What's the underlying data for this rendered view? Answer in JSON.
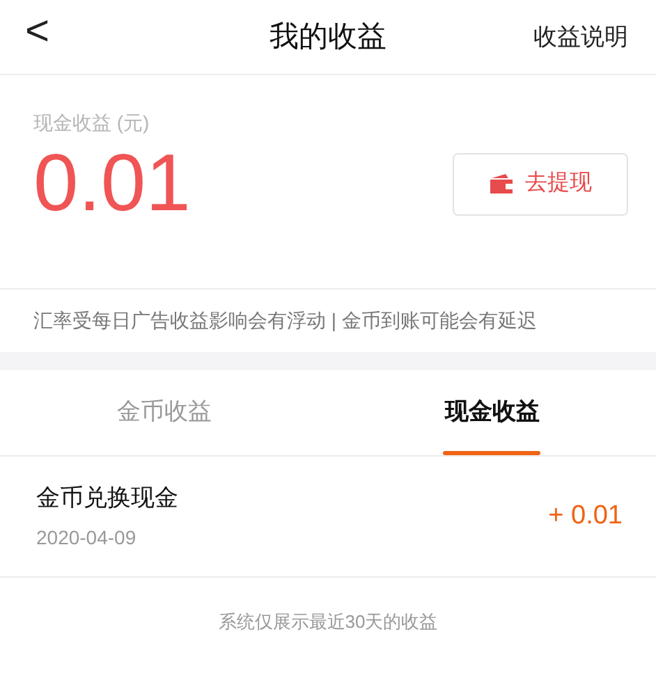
{
  "header": {
    "back": "<",
    "title": "我的收益",
    "action": "收益说明"
  },
  "balance": {
    "label": "现金收益 (元)",
    "amount": "0.01",
    "withdraw_button": "去提现"
  },
  "notice": "汇率受每日广告收益影响会有浮动 | 金币到账可能会有延迟",
  "tabs": [
    {
      "label": "金币收益",
      "selected": false
    },
    {
      "label": "现金收益",
      "selected": true
    }
  ],
  "records": [
    {
      "title": "金币兑换现金",
      "date": "2020-04-09",
      "amount": "+ 0.01"
    }
  ],
  "footer": "系统仅展示最近30天的收益"
}
